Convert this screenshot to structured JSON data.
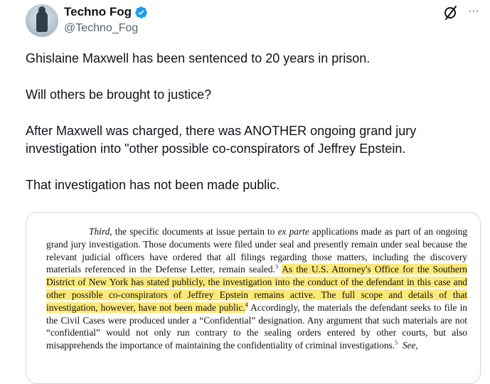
{
  "author": {
    "display_name": "Techno Fog",
    "handle": "@Techno_Fog",
    "verified_color": "#1d9bf0"
  },
  "actions": {
    "grok_icon": "grok-icon",
    "more_icon": "more-icon",
    "more_glyph": "···"
  },
  "tweet": {
    "paragraphs": [
      "Ghislaine Maxwell has been sentenced to 20 years in prison.",
      "Will others be brought to justice?",
      "After Maxwell was charged, there was ANOTHER ongoing grand jury investigation into \"other possible co-conspirators of Jeffrey Epstein.",
      "That investigation has not been made public."
    ]
  },
  "document": {
    "seg1_italic": "Third",
    "seg2": ", the specific documents at issue pertain to ",
    "seg3_italic": "ex parte",
    "seg4": " applications made as part of an ongoing grand jury investigation.  Those documents were filed under seal and presently remain under seal because the relevant judicial officers have ordered that all filings regarding those matters, including the discovery materials referenced in the Defense Letter, remain sealed.",
    "fn3": "3",
    "highlight": "As the U.S. Attorney's Office for the Southern District of New York has stated publicly, the investigation into the conduct of the defendant in this case and other possible co-conspirators of Jeffrey Epstein remains active.  The full scope and details of that investigation, however, have not been made public.",
    "fn4": "4",
    "seg5": " Accordingly, the materials the defendant seeks to file in the Civil Cases were produced under a “Confidential” designation.  Any argument that such materials are not “confidential” would not only run contrary to the sealing orders entered by other courts, but also misapprehends the importance of maintaining the confidentiality of criminal investigations.",
    "fn5": "5",
    "seg6_italic": "See",
    "seg7": ","
  },
  "colors": {
    "highlight": "#fde97a",
    "text": "#0f1419",
    "secondary": "#536471"
  }
}
